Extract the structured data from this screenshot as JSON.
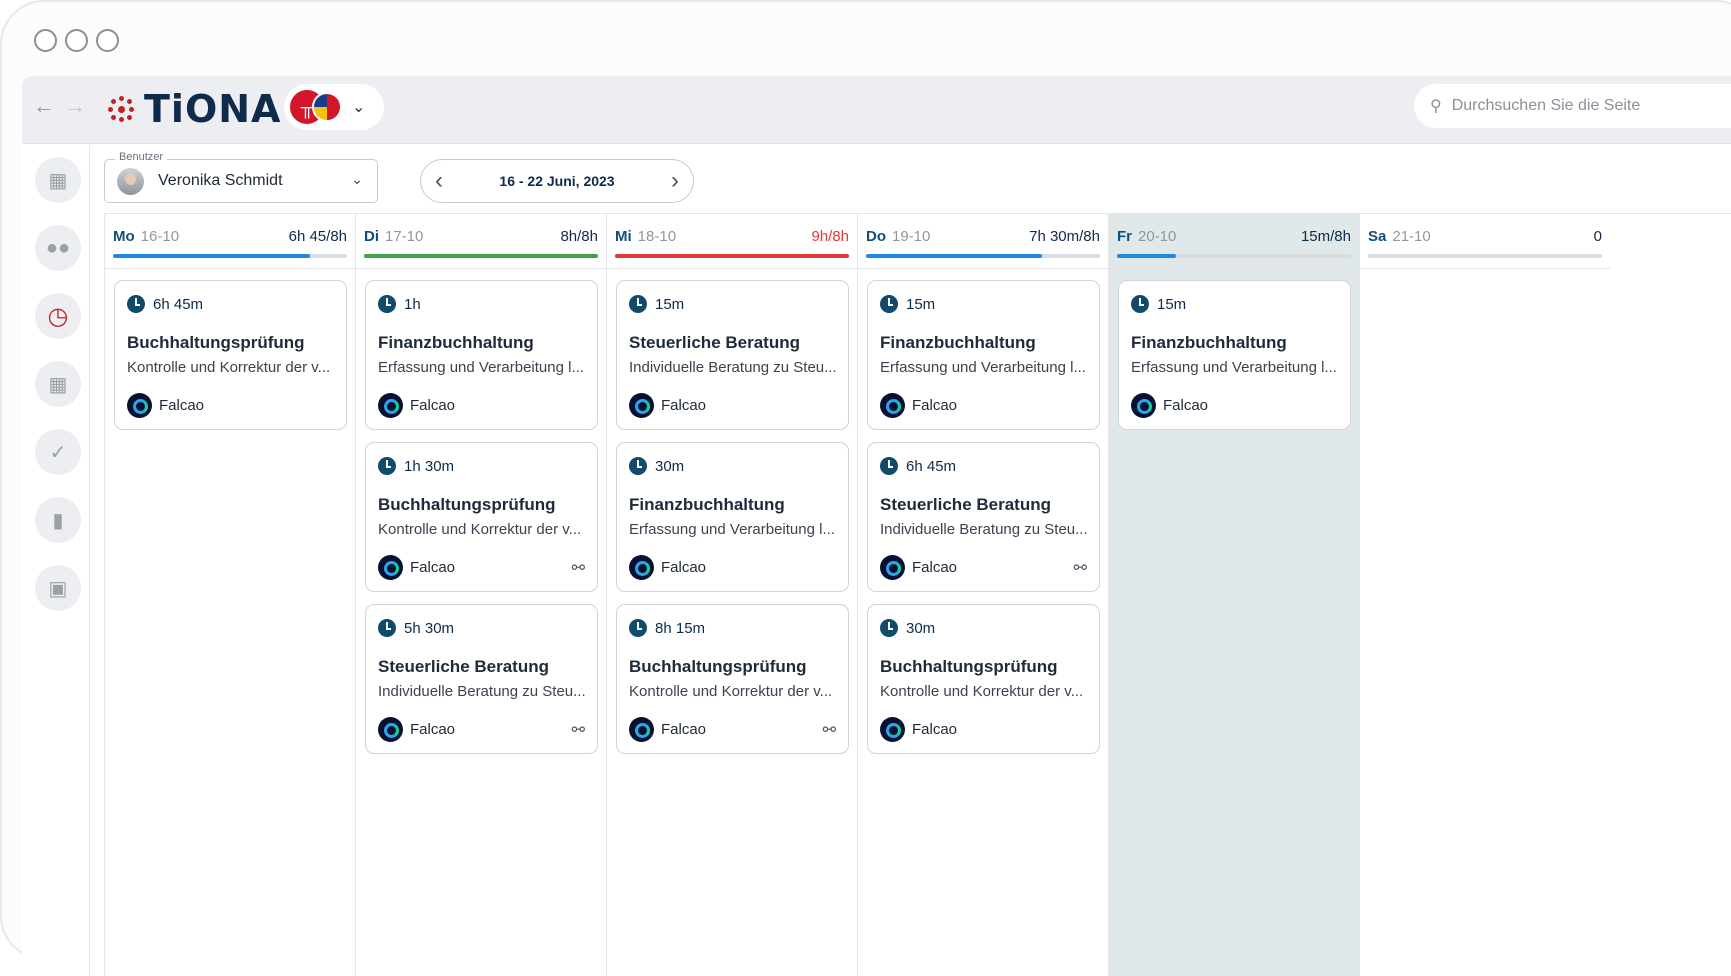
{
  "window": {
    "controls": [
      "close",
      "minimize",
      "maximize"
    ]
  },
  "topbar": {
    "back_icon": "arrow-left-icon",
    "forward_icon": "arrow-right-icon",
    "logo_text": "TiONA",
    "search_placeholder": "Durchsuchen Sie die Seite"
  },
  "sidebar": {
    "items": [
      "dashboard-icon",
      "team-icon",
      "time-add-icon",
      "calendar-icon",
      "task-check-icon",
      "document-icon",
      "briefcase-icon"
    ],
    "active_color": "#c62026"
  },
  "filters": {
    "user_legend": "Benutzer",
    "user_name": "Veronika Schmidt",
    "week_range": "16 - 22 Juni, 2023"
  },
  "colors": {
    "accent": "#0f2a4a",
    "blue": "#1e88e5",
    "green": "#43a047",
    "red": "#e53935",
    "friday_bg": "#e1e8ea"
  },
  "days": [
    {
      "name": "Mo",
      "date": "16-10",
      "hours": "6h 45/8h",
      "progress": 0.84,
      "bar_color": "#1e88e5",
      "over": false,
      "highlight": false,
      "entries": [
        {
          "duration": "6h 45m",
          "title": "Buchhaltungsprüfung",
          "desc": "Kontrolle und Korrektur der v...",
          "client": "Falcao",
          "linked": false
        }
      ]
    },
    {
      "name": "Di",
      "date": "17-10",
      "hours": "8h/8h",
      "progress": 1.0,
      "bar_color": "#43a047",
      "over": false,
      "highlight": false,
      "entries": [
        {
          "duration": "1h",
          "title": "Finanzbuchhaltung",
          "desc": "Erfassung und Verarbeitung l...",
          "client": "Falcao",
          "linked": false
        },
        {
          "duration": "1h 30m",
          "title": "Buchhaltungsprüfung",
          "desc": "Kontrolle und Korrektur der v...",
          "client": "Falcao",
          "linked": true
        },
        {
          "duration": "5h 30m",
          "title": "Steuerliche Beratung",
          "desc": "Individuelle Beratung zu Steu...",
          "client": "Falcao",
          "linked": true
        }
      ]
    },
    {
      "name": "Mi",
      "date": "18-10",
      "hours": "9h/8h",
      "progress": 1.0,
      "bar_color": "#e53935",
      "over": true,
      "highlight": false,
      "entries": [
        {
          "duration": "15m",
          "title": "Steuerliche Beratung",
          "desc": "Individuelle Beratung zu Steu...",
          "client": "Falcao",
          "linked": false
        },
        {
          "duration": "30m",
          "title": "Finanzbuchhaltung",
          "desc": "Erfassung und Verarbeitung l...",
          "client": "Falcao",
          "linked": false
        },
        {
          "duration": "8h 15m",
          "title": "Buchhaltungsprüfung",
          "desc": "Kontrolle und Korrektur der v...",
          "client": "Falcao",
          "linked": true
        }
      ]
    },
    {
      "name": "Do",
      "date": "19-10",
      "hours": "7h 30m/8h",
      "progress": 0.75,
      "bar_color": "#1e88e5",
      "over": false,
      "highlight": false,
      "entries": [
        {
          "duration": "15m",
          "title": "Finanzbuchhaltung",
          "desc": "Erfassung und Verarbeitung l...",
          "client": "Falcao",
          "linked": false
        },
        {
          "duration": "6h 45m",
          "title": "Steuerliche Beratung",
          "desc": "Individuelle Beratung zu Steu...",
          "client": "Falcao",
          "linked": true
        },
        {
          "duration": "30m",
          "title": "Buchhaltungsprüfung",
          "desc": "Kontrolle und Korrektur der v...",
          "client": "Falcao",
          "linked": false
        }
      ]
    },
    {
      "name": "Fr",
      "date": "20-10",
      "hours": "15m/8h",
      "progress": 0.25,
      "bar_color": "#1e88e5",
      "over": false,
      "highlight": true,
      "entries": [
        {
          "duration": "15m",
          "title": "Finanzbuchhaltung",
          "desc": "Erfassung und Verarbeitung l...",
          "client": "Falcao",
          "linked": false
        }
      ]
    },
    {
      "name": "Sa",
      "date": "21-10",
      "hours": "0",
      "progress": 0,
      "bar_color": "#1e88e5",
      "over": false,
      "highlight": false,
      "entries": []
    }
  ]
}
